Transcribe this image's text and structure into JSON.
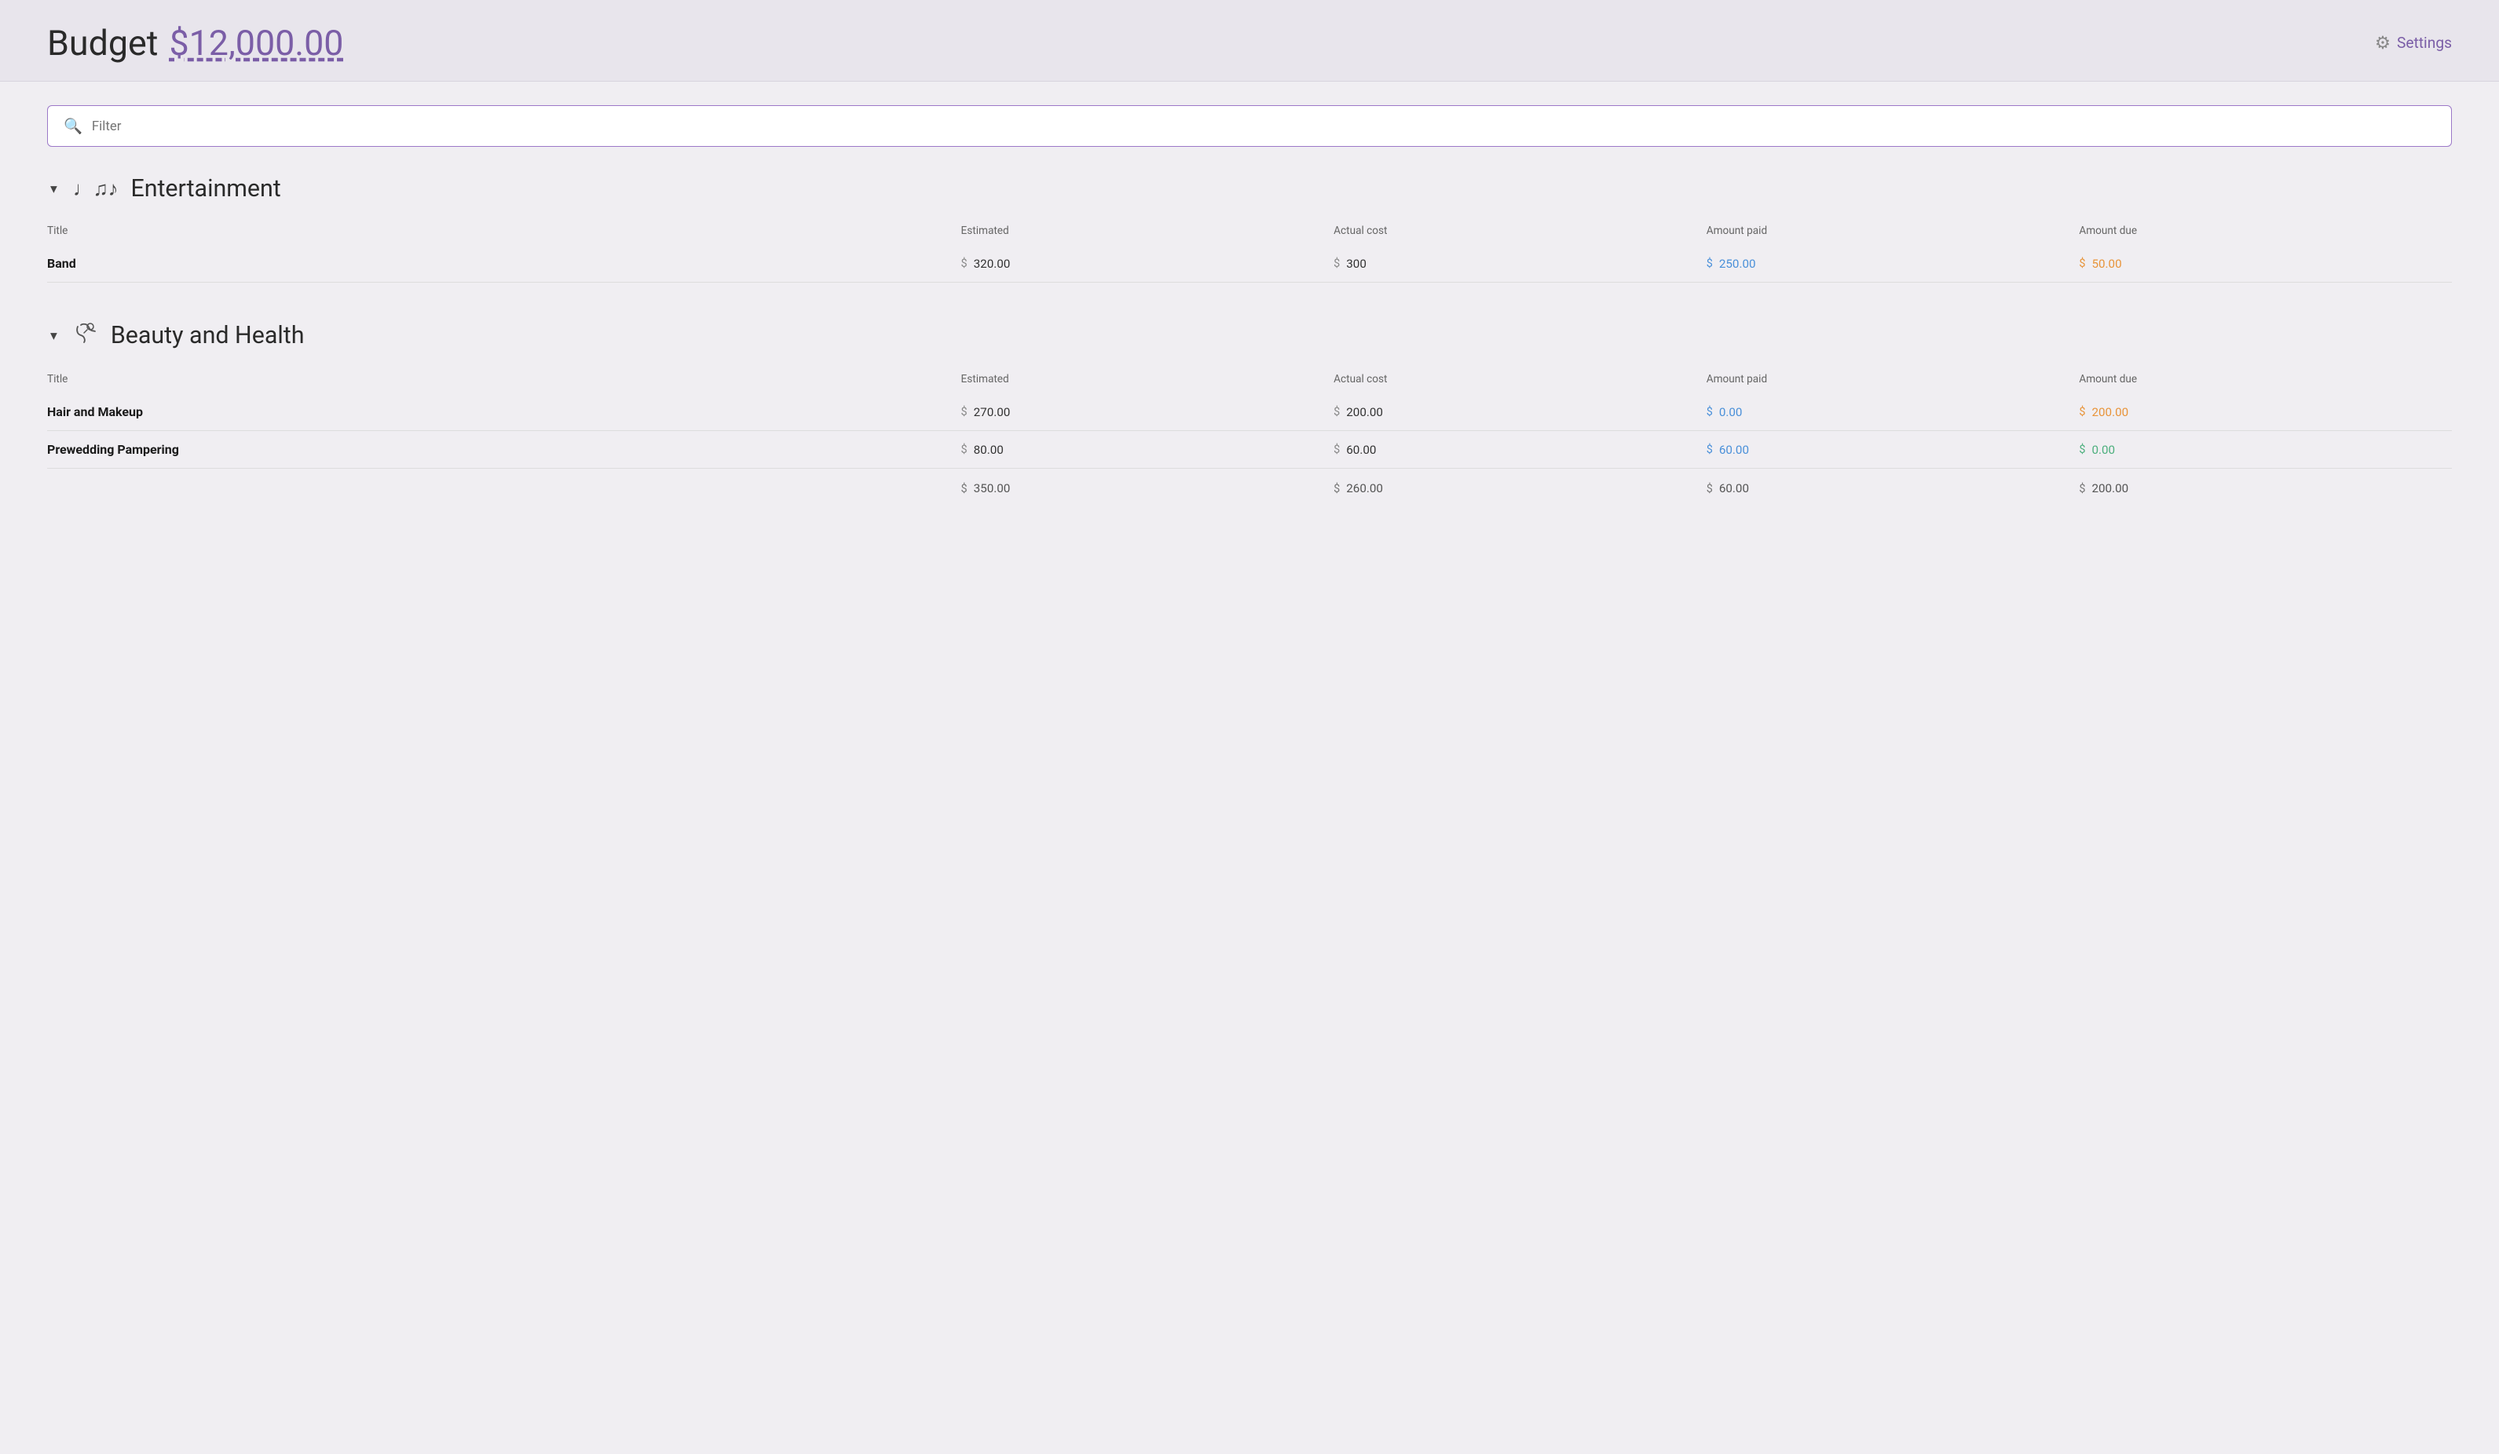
{
  "header": {
    "title": "Budget",
    "amount": "$12,000.00",
    "settings_label": "Settings"
  },
  "filter": {
    "placeholder": "Filter"
  },
  "sections": [
    {
      "id": "entertainment",
      "title": "Entertainment",
      "icon": "♩♫♪",
      "expanded": true,
      "columns": [
        "Title",
        "Estimated",
        "Actual cost",
        "Amount paid",
        "Amount due"
      ],
      "items": [
        {
          "title": "Band",
          "estimated": "320.00",
          "actual_cost": "300",
          "amount_paid": "250.00",
          "amount_due": "50.00",
          "paid_color": "blue",
          "due_color": "orange"
        }
      ],
      "totals": null
    },
    {
      "id": "beauty-health",
      "title": "Beauty and Health",
      "icon": "💨",
      "expanded": true,
      "columns": [
        "Title",
        "Estimated",
        "Actual cost",
        "Amount paid",
        "Amount due"
      ],
      "items": [
        {
          "title": "Hair and Makeup",
          "estimated": "270.00",
          "actual_cost": "200.00",
          "amount_paid": "0.00",
          "amount_due": "200.00",
          "paid_color": "blue",
          "due_color": "orange"
        },
        {
          "title": "Prewedding Pampering",
          "estimated": "80.00",
          "actual_cost": "60.00",
          "amount_paid": "60.00",
          "amount_due": "0.00",
          "paid_color": "blue",
          "due_color": "green"
        }
      ],
      "totals": {
        "estimated": "350.00",
        "actual_cost": "260.00",
        "amount_paid": "60.00",
        "amount_due": "200.00"
      }
    }
  ]
}
